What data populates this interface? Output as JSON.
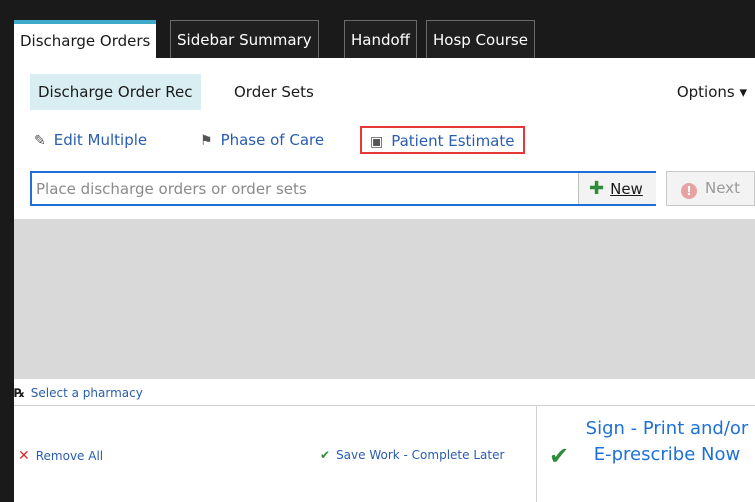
{
  "tabs": [
    {
      "label": "Discharge Orders",
      "active": true
    },
    {
      "label": "Sidebar Summary",
      "active": false
    },
    {
      "label": "Handoff",
      "active": false
    },
    {
      "label": "Hosp Course",
      "active": false
    }
  ],
  "subtabs": [
    {
      "label": "Discharge Order Rec",
      "active": true
    },
    {
      "label": "Order Sets",
      "active": false
    }
  ],
  "options_label": "Options ▾",
  "actions": {
    "edit_multiple": "Edit Multiple",
    "phase_of_care": "Phase of Care",
    "patient_estimate": "Patient Estimate"
  },
  "search": {
    "placeholder": "Place discharge orders or order sets",
    "new_label": "New",
    "next_label": "Next"
  },
  "pharmacy_label": "Select a pharmacy",
  "bottom": {
    "remove_all": "Remove All",
    "save_work": "Save Work - Complete Later",
    "sign_label": "Sign - Print and/or E-prescribe Now"
  },
  "colors": {
    "accent_blue": "#1e6fd9",
    "link_blue": "#2a5db0",
    "highlight_red": "#e53935",
    "active_tab_border": "#3fa9c9",
    "success_green": "#2e8b3a"
  },
  "icons": {
    "edit_multiple": "pencil-icon",
    "phase_of_care": "phase-icon",
    "patient_estimate": "money-icon",
    "new": "plus-icon",
    "next": "warning-icon",
    "pharmacy": "rx-icon",
    "remove_all": "x-icon",
    "save_work": "save-icon",
    "sign": "checkmark-icon"
  }
}
